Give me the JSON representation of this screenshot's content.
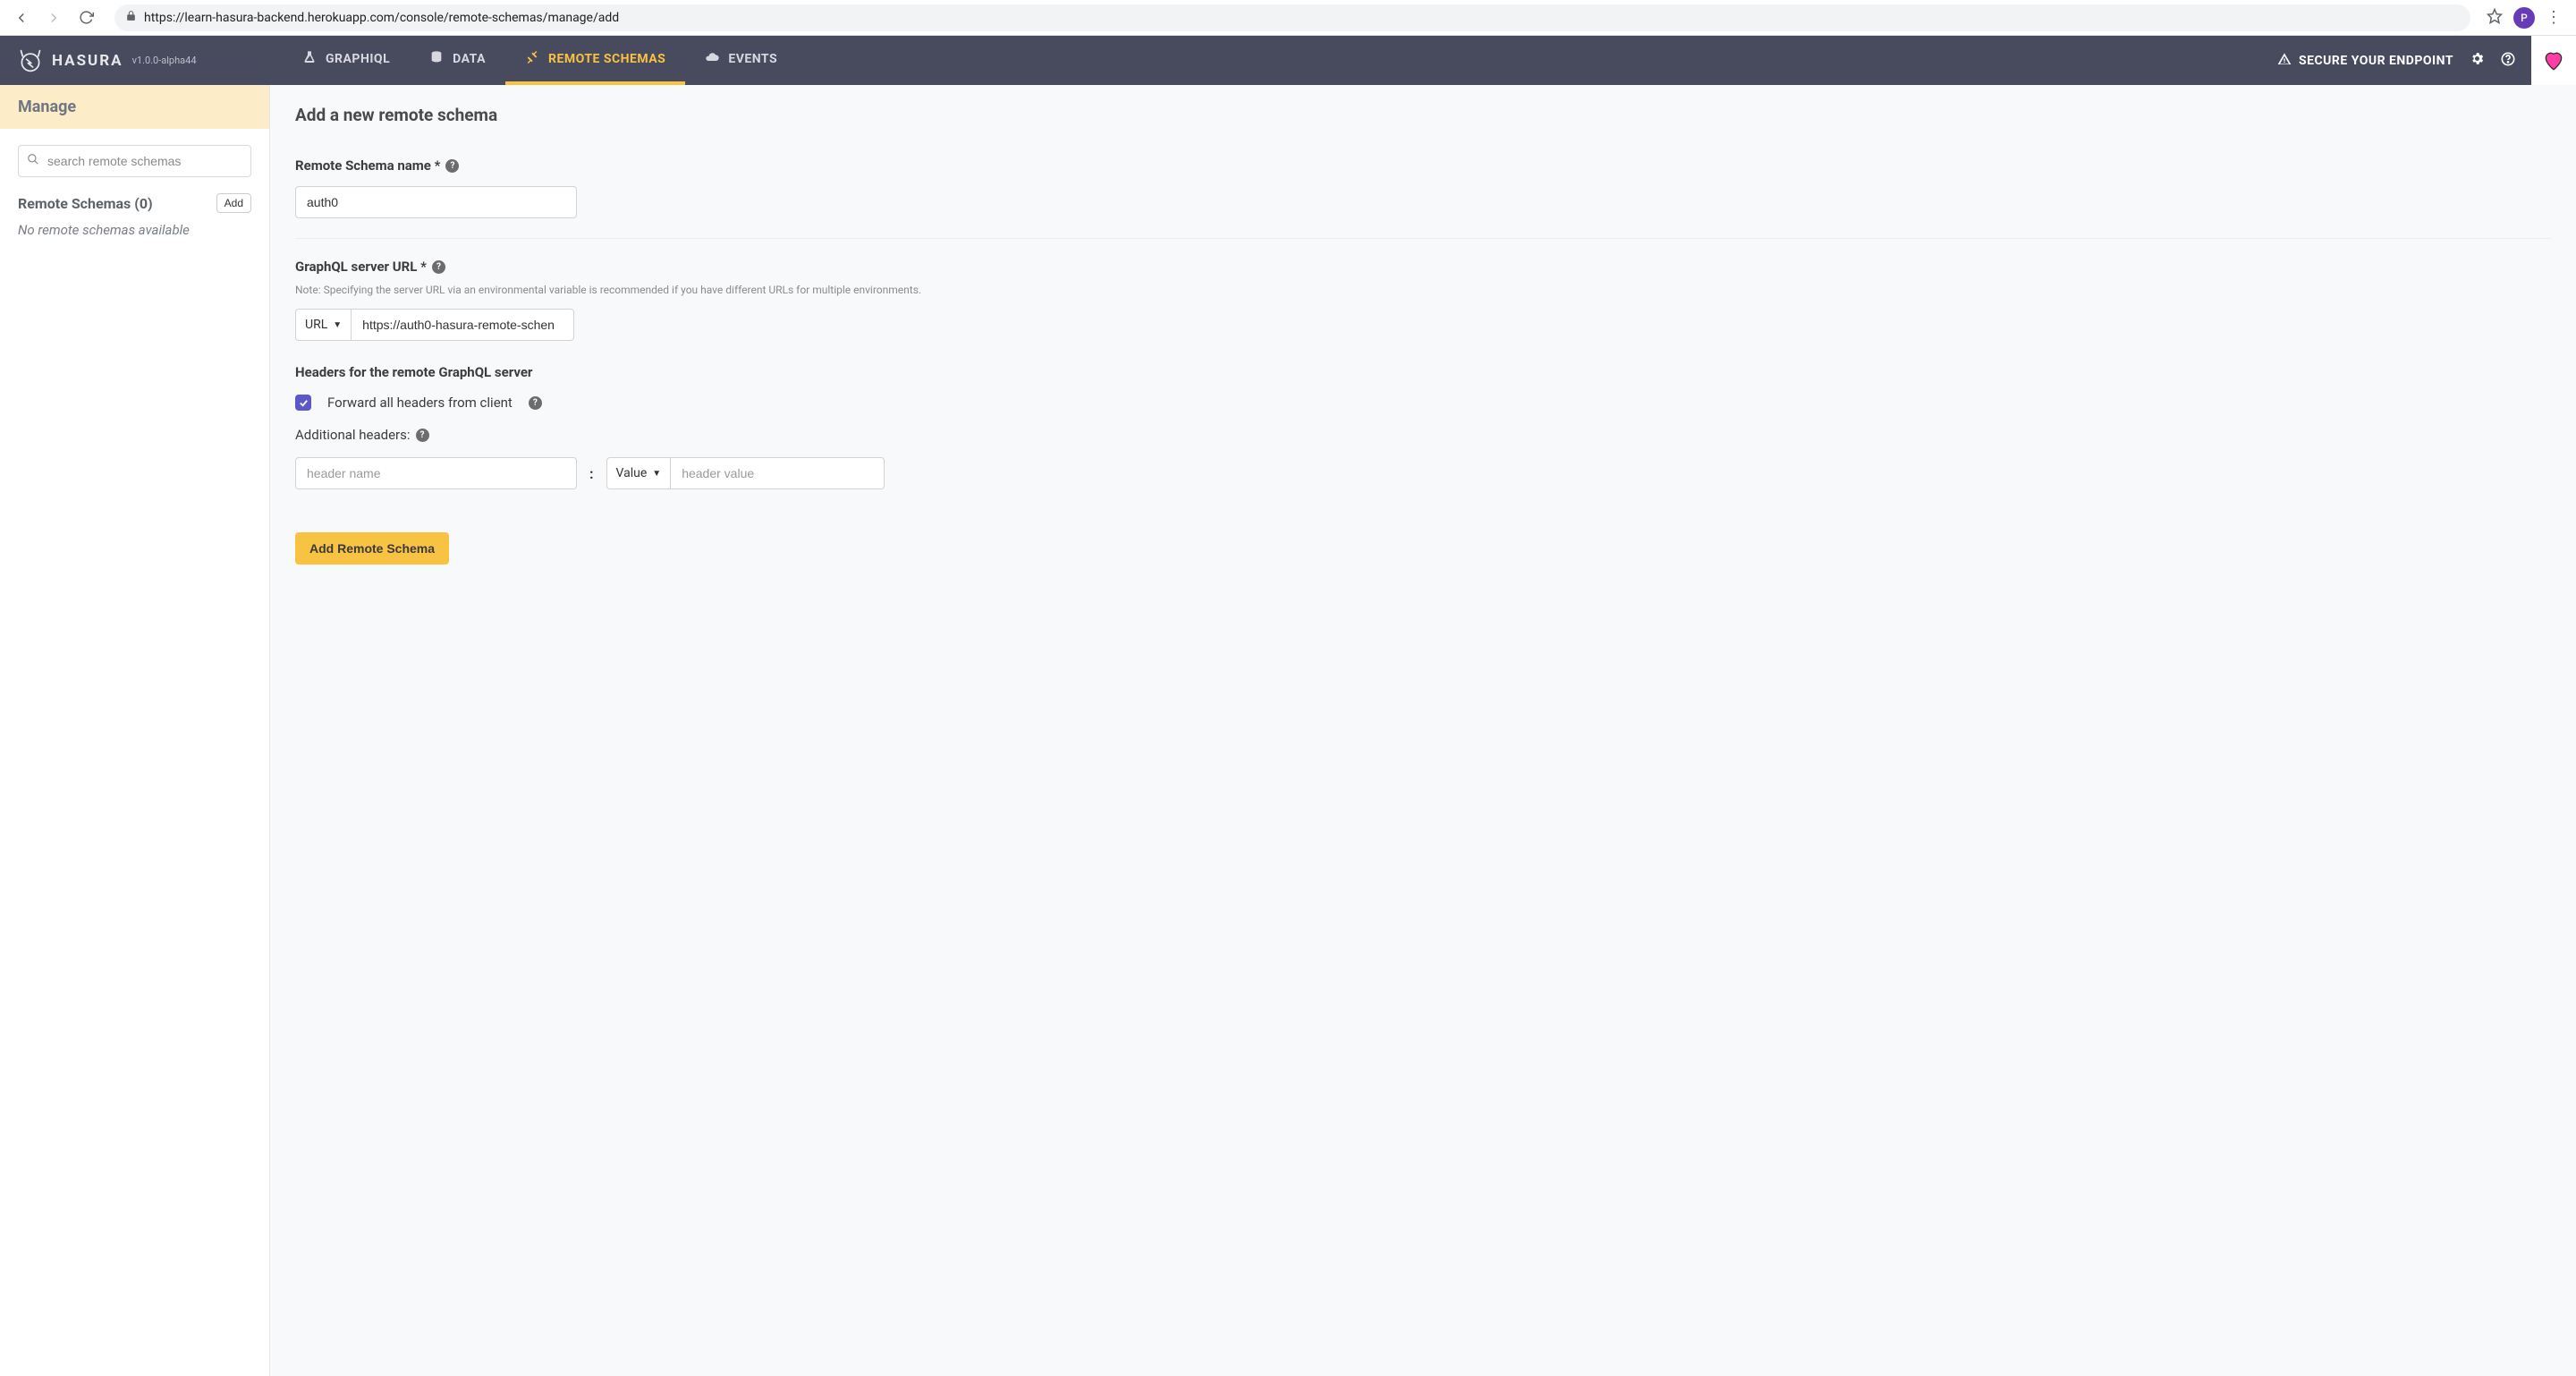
{
  "browser": {
    "url": "https://learn-hasura-backend.herokuapp.com/console/remote-schemas/manage/add",
    "profile_initial": "P"
  },
  "topnav": {
    "brand": "HASURA",
    "version": "v1.0.0-alpha44",
    "tabs": [
      {
        "label": "GRAPHIQL"
      },
      {
        "label": "DATA"
      },
      {
        "label": "REMOTE SCHEMAS"
      },
      {
        "label": "EVENTS"
      }
    ],
    "secure": "SECURE YOUR ENDPOINT"
  },
  "sidebar": {
    "header": "Manage",
    "search_placeholder": "search remote schemas",
    "list_title": "Remote Schemas (0)",
    "add_label": "Add",
    "empty_text": "No remote schemas available"
  },
  "form": {
    "page_title": "Add a new remote schema",
    "name_label": "Remote Schema name *",
    "name_value": "auth0",
    "url_label": "GraphQL server URL *",
    "url_note": "Note: Specifying the server URL via an environmental variable is recommended if you have different URLs for multiple environments.",
    "url_type": "URL",
    "url_value": "https://auth0-hasura-remote-schen",
    "headers_label": "Headers for the remote GraphQL server",
    "forward_label": "Forward all headers from client",
    "forward_checked": true,
    "additional_label": "Additional headers:",
    "header_name_placeholder": "header name",
    "header_value_type": "Value",
    "header_value_placeholder": "header value",
    "submit_label": "Add Remote Schema"
  }
}
